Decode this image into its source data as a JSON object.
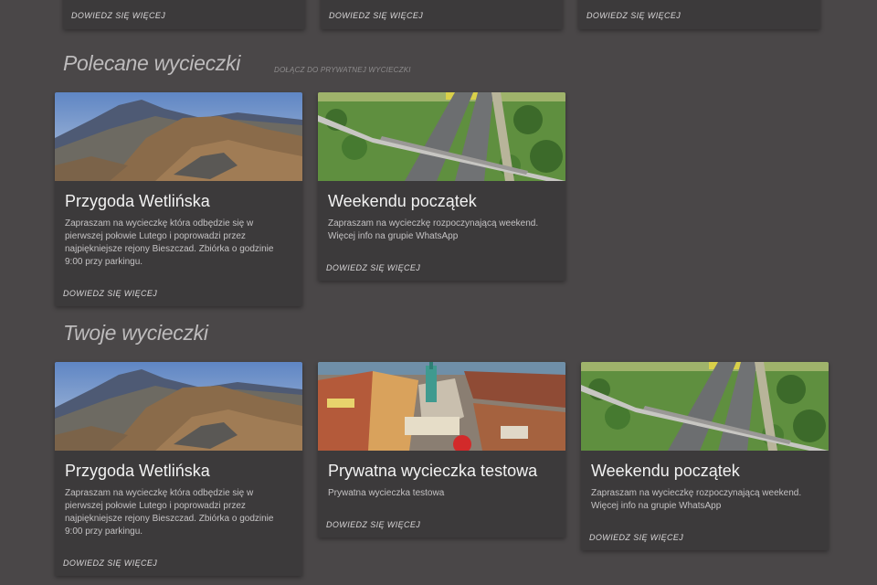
{
  "top_row": {
    "cards": [
      {
        "link": "DOWIEDZ SIĘ WIĘCEJ"
      },
      {
        "link": "DOWIEDZ SIĘ WIĘCEJ"
      },
      {
        "link": "DOWIEDZ SIĘ WIĘCEJ"
      }
    ]
  },
  "recommended": {
    "title": "Polecane wycieczki",
    "subtitle": "DOŁĄCZ DO PRYWATNEJ WYCIECZKI",
    "cards": [
      {
        "title": "Przygoda Wetlińska",
        "description": "Zapraszam na wycieczkę która odbędzie się w pierwszej połowie Lutego i poprowadzi przez najpiękniejsze rejony Bieszczad. Zbiórka o godzinie 9:00 przy parkingu.",
        "link": "DOWIEDZ SIĘ WIĘCEJ",
        "image": "mountain-trail-photo"
      },
      {
        "title": "Weekendu początek",
        "description": "Zapraszam na wycieczkę rozpoczynającą weekend. Więcej info na grupie WhatsApp",
        "link": "DOWIEDZ SIĘ WIĘCEJ",
        "image": "highway-bridge-photo"
      }
    ]
  },
  "yours": {
    "title": "Twoje wycieczki",
    "cards": [
      {
        "title": "Przygoda Wetlińska",
        "description": "Zapraszam na wycieczkę która odbędzie się w pierwszej połowie Lutego i poprowadzi przez najpiękniejsze rejony Bieszczad. Zbiórka o godzinie 9:00 przy parkingu.",
        "link": "DOWIEDZ SIĘ WIĘCEJ",
        "image": "mountain-trail-photo"
      },
      {
        "title": "Prywatna wycieczka testowa",
        "description": "Prywatna wycieczka testowa",
        "link": "DOWIEDZ SIĘ WIĘCEJ",
        "image": "town-square-aerial-photo"
      },
      {
        "title": "Weekendu początek",
        "description": "Zapraszam na wycieczkę rozpoczynającą weekend. Więcej info na grupie WhatsApp",
        "link": "DOWIEDZ SIĘ WIĘCEJ",
        "image": "highway-bridge-photo"
      }
    ]
  }
}
